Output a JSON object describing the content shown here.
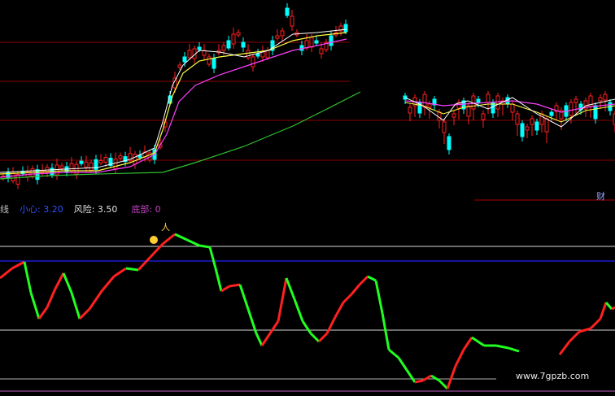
{
  "indicator_bar": {
    "item1_label": "线",
    "item2_label": "小心",
    "item2_value": "3.20",
    "item3_label": "风险",
    "item3_value": "3.50",
    "item4_label": "底部",
    "item4_value": "0"
  },
  "right_tag": "财",
  "watermark": "www.7gpzb.com",
  "colors": {
    "up": "#ff2020",
    "down": "#00ffff",
    "ma_fast": "#ffffff",
    "ma_mid": "#ffff40",
    "ma_slow": "#ff40ff",
    "ma_long": "#30c030",
    "osc_up": "#ff2020",
    "osc_down": "#20ff20",
    "ref_top": "#d8d8d8",
    "ref_mid": "#2020ff",
    "axis": "#9a0000"
  }
}
